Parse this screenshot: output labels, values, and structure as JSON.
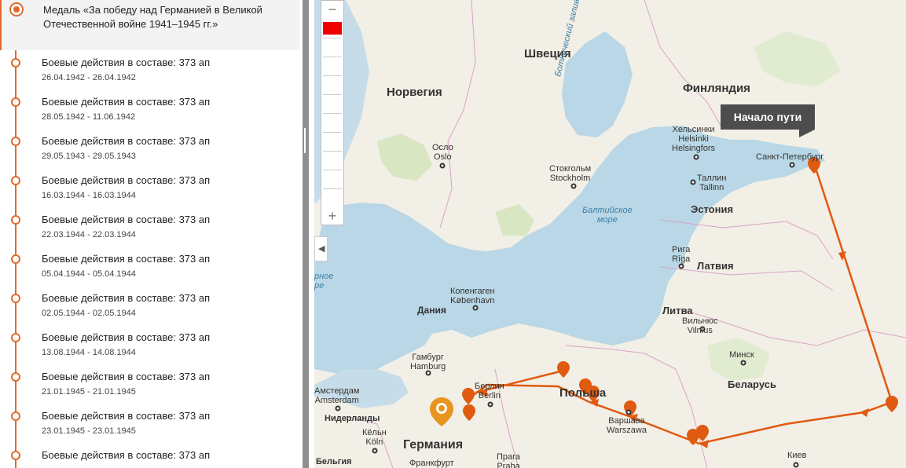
{
  "sidebar": {
    "events": [
      {
        "title": "Медаль «За победу над Германией в Великой Отечественной войне 1941–1945 гг.»",
        "date": ""
      },
      {
        "title": "Боевые действия в составе: 373 ап",
        "date": "26.04.1942 - 26.04.1942"
      },
      {
        "title": "Боевые действия в составе: 373 ап",
        "date": "28.05.1942 - 11.06.1942"
      },
      {
        "title": "Боевые действия в составе: 373 ап",
        "date": "29.05.1943 - 29.05.1943"
      },
      {
        "title": "Боевые действия в составе: 373 ап",
        "date": "16.03.1944 - 16.03.1944"
      },
      {
        "title": "Боевые действия в составе: 373 ап",
        "date": "22.03.1944 - 22.03.1944"
      },
      {
        "title": "Боевые действия в составе: 373 ап",
        "date": "05.04.1944 - 05.04.1944"
      },
      {
        "title": "Боевые действия в составе: 373 ап",
        "date": "02.05.1944 - 02.05.1944"
      },
      {
        "title": "Боевые действия в составе: 373 ап",
        "date": "13.08.1944 - 14.08.1944"
      },
      {
        "title": "Боевые действия в составе: 373 ап",
        "date": "21.01.1945 - 21.01.1945"
      },
      {
        "title": "Боевые действия в составе: 373 ап",
        "date": "23.01.1945 - 23.01.1945"
      },
      {
        "title": "Боевые действия в составе: 373 ап",
        "date": ""
      }
    ]
  },
  "map": {
    "zoom": {
      "minus": "−",
      "plus": "+"
    },
    "collapse_icon": "◀",
    "tooltip": "Начало пути",
    "countries": {
      "sweden": "Швеция",
      "finland": "Финляндия",
      "norway": "Норвегия",
      "estonia": "Эстония",
      "latvia": "Латвия",
      "lithuania": "Литва",
      "denmark": "Дания",
      "belarus": "Беларусь",
      "poland": "Польша",
      "germany": "Германия",
      "netherlands": "Нидерланды",
      "belgium": "Бельгия"
    },
    "cities": {
      "helsinki": "Хельсинки\nHelsinki\nHelsingfors",
      "spb": "Санкт-Петербург",
      "oslo": "Осло\nOslo",
      "stockholm": "Стокгольм\nStockholm",
      "tallinn": "Таллин\nTallinn",
      "riga": "Рига\nRīga",
      "copenhagen": "Копенгаген\nKøbenhavn",
      "vilnius": "Вильнюс\nVilnius",
      "minsk": "Минск",
      "hamburg": "Гамбург\nHamburg",
      "amsterdam": "Амстердам\nAmsterdam",
      "berlin": "Берлин\nBerlin",
      "warsaw": "Варшава\nWarszawa",
      "koln": "Кёльн\nKöln",
      "praha": "Прага\nPraha",
      "frankfurt": "Франкфурт",
      "kiev": "Киев"
    },
    "seas": {
      "baltic": "Балтийское\nморе",
      "bothnia": "Ботнический залив",
      "north": "рное\nре"
    },
    "colors": {
      "route": "#e05a10",
      "accent": "#e06a2c",
      "land": "#f2efe6",
      "water": "#b9d7e6",
      "forest": "#d8e6c2"
    }
  }
}
